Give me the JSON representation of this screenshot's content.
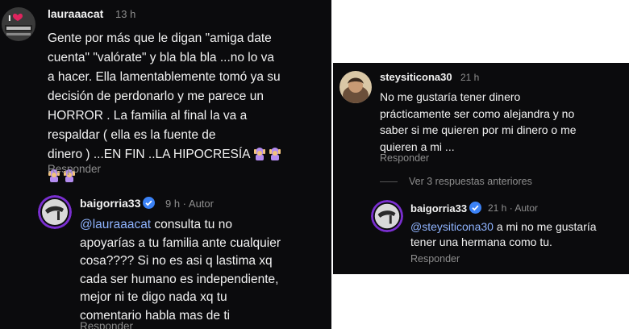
{
  "left": {
    "comment": {
      "username": "lauraaacat",
      "time": "13 h",
      "lines": [
        "Gente por más que le digan \"amiga date",
        "cuenta\" \"valórate\" y bla bla bla ...no lo va",
        "a hacer. Ella lamentablemente tomó ya su",
        "decisión de perdonarlo y me parece un",
        "HORROR . La familia al final la va a",
        "respaldar ( ella es la fuente de",
        "dinero ) ...EN FIN ..LA HIPOCRESÍA"
      ],
      "reply_label": "Responder"
    },
    "reply": {
      "username": "baigorria33",
      "meta": "9 h · Autor",
      "mention": "@lauraaacat",
      "first_line_rest": " consulta tu no",
      "lines": [
        "apoyarías a tu familia ante cualquier",
        "cosa???? Si no es asi q lastima xq",
        "cada ser humano es independiente,",
        "mejor ni te digo nada xq tu",
        "comentario habla mas de ti"
      ],
      "reply_label": "Responder"
    }
  },
  "right": {
    "comment": {
      "username": "steysiticona30",
      "time": "21 h",
      "lines": [
        "No me gustaría tener dinero",
        "prácticamente ser como alejandra y no",
        "saber si me quieren por mi dinero o me",
        "quieren a mi ..."
      ],
      "reply_label": "Responder"
    },
    "view_previous": "Ver 3 respuestas anteriores",
    "reply": {
      "username": "baigorria33",
      "meta": "21 h · Autor",
      "mention": "@steysiticona30",
      "first_line_rest": " a mi no me gustaría",
      "lines": [
        "tener una hermana como tu."
      ],
      "reply_label": "Responder"
    }
  },
  "colors": {
    "background": "#0b0b0d",
    "text": "#f2f2f2",
    "meta": "#8e8e8e",
    "mention": "#8fb4ff",
    "verified": "#3b82f6"
  },
  "icons": [
    "verified-badge-icon",
    "woman-facepalming-emoji",
    "avatar-image"
  ]
}
